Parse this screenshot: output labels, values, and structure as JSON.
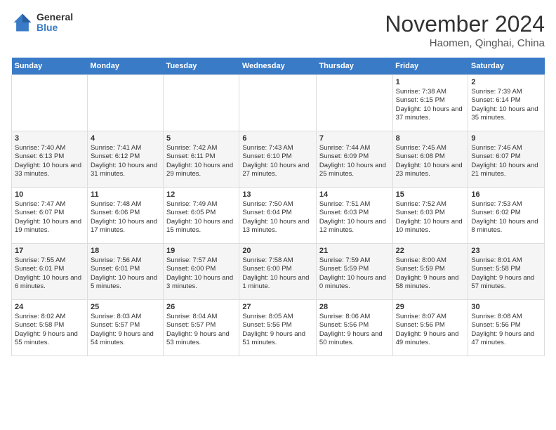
{
  "header": {
    "logo_general": "General",
    "logo_blue": "Blue",
    "month_title": "November 2024",
    "location": "Haomen, Qinghai, China"
  },
  "days_of_week": [
    "Sunday",
    "Monday",
    "Tuesday",
    "Wednesday",
    "Thursday",
    "Friday",
    "Saturday"
  ],
  "weeks": [
    [
      {
        "day": "",
        "sunrise": "",
        "sunset": "",
        "daylight": ""
      },
      {
        "day": "",
        "sunrise": "",
        "sunset": "",
        "daylight": ""
      },
      {
        "day": "",
        "sunrise": "",
        "sunset": "",
        "daylight": ""
      },
      {
        "day": "",
        "sunrise": "",
        "sunset": "",
        "daylight": ""
      },
      {
        "day": "",
        "sunrise": "",
        "sunset": "",
        "daylight": ""
      },
      {
        "day": "1",
        "sunrise": "Sunrise: 7:38 AM",
        "sunset": "Sunset: 6:15 PM",
        "daylight": "Daylight: 10 hours and 37 minutes."
      },
      {
        "day": "2",
        "sunrise": "Sunrise: 7:39 AM",
        "sunset": "Sunset: 6:14 PM",
        "daylight": "Daylight: 10 hours and 35 minutes."
      }
    ],
    [
      {
        "day": "3",
        "sunrise": "Sunrise: 7:40 AM",
        "sunset": "Sunset: 6:13 PM",
        "daylight": "Daylight: 10 hours and 33 minutes."
      },
      {
        "day": "4",
        "sunrise": "Sunrise: 7:41 AM",
        "sunset": "Sunset: 6:12 PM",
        "daylight": "Daylight: 10 hours and 31 minutes."
      },
      {
        "day": "5",
        "sunrise": "Sunrise: 7:42 AM",
        "sunset": "Sunset: 6:11 PM",
        "daylight": "Daylight: 10 hours and 29 minutes."
      },
      {
        "day": "6",
        "sunrise": "Sunrise: 7:43 AM",
        "sunset": "Sunset: 6:10 PM",
        "daylight": "Daylight: 10 hours and 27 minutes."
      },
      {
        "day": "7",
        "sunrise": "Sunrise: 7:44 AM",
        "sunset": "Sunset: 6:09 PM",
        "daylight": "Daylight: 10 hours and 25 minutes."
      },
      {
        "day": "8",
        "sunrise": "Sunrise: 7:45 AM",
        "sunset": "Sunset: 6:08 PM",
        "daylight": "Daylight: 10 hours and 23 minutes."
      },
      {
        "day": "9",
        "sunrise": "Sunrise: 7:46 AM",
        "sunset": "Sunset: 6:07 PM",
        "daylight": "Daylight: 10 hours and 21 minutes."
      }
    ],
    [
      {
        "day": "10",
        "sunrise": "Sunrise: 7:47 AM",
        "sunset": "Sunset: 6:07 PM",
        "daylight": "Daylight: 10 hours and 19 minutes."
      },
      {
        "day": "11",
        "sunrise": "Sunrise: 7:48 AM",
        "sunset": "Sunset: 6:06 PM",
        "daylight": "Daylight: 10 hours and 17 minutes."
      },
      {
        "day": "12",
        "sunrise": "Sunrise: 7:49 AM",
        "sunset": "Sunset: 6:05 PM",
        "daylight": "Daylight: 10 hours and 15 minutes."
      },
      {
        "day": "13",
        "sunrise": "Sunrise: 7:50 AM",
        "sunset": "Sunset: 6:04 PM",
        "daylight": "Daylight: 10 hours and 13 minutes."
      },
      {
        "day": "14",
        "sunrise": "Sunrise: 7:51 AM",
        "sunset": "Sunset: 6:03 PM",
        "daylight": "Daylight: 10 hours and 12 minutes."
      },
      {
        "day": "15",
        "sunrise": "Sunrise: 7:52 AM",
        "sunset": "Sunset: 6:03 PM",
        "daylight": "Daylight: 10 hours and 10 minutes."
      },
      {
        "day": "16",
        "sunrise": "Sunrise: 7:53 AM",
        "sunset": "Sunset: 6:02 PM",
        "daylight": "Daylight: 10 hours and 8 minutes."
      }
    ],
    [
      {
        "day": "17",
        "sunrise": "Sunrise: 7:55 AM",
        "sunset": "Sunset: 6:01 PM",
        "daylight": "Daylight: 10 hours and 6 minutes."
      },
      {
        "day": "18",
        "sunrise": "Sunrise: 7:56 AM",
        "sunset": "Sunset: 6:01 PM",
        "daylight": "Daylight: 10 hours and 5 minutes."
      },
      {
        "day": "19",
        "sunrise": "Sunrise: 7:57 AM",
        "sunset": "Sunset: 6:00 PM",
        "daylight": "Daylight: 10 hours and 3 minutes."
      },
      {
        "day": "20",
        "sunrise": "Sunrise: 7:58 AM",
        "sunset": "Sunset: 6:00 PM",
        "daylight": "Daylight: 10 hours and 1 minute."
      },
      {
        "day": "21",
        "sunrise": "Sunrise: 7:59 AM",
        "sunset": "Sunset: 5:59 PM",
        "daylight": "Daylight: 10 hours and 0 minutes."
      },
      {
        "day": "22",
        "sunrise": "Sunrise: 8:00 AM",
        "sunset": "Sunset: 5:59 PM",
        "daylight": "Daylight: 9 hours and 58 minutes."
      },
      {
        "day": "23",
        "sunrise": "Sunrise: 8:01 AM",
        "sunset": "Sunset: 5:58 PM",
        "daylight": "Daylight: 9 hours and 57 minutes."
      }
    ],
    [
      {
        "day": "24",
        "sunrise": "Sunrise: 8:02 AM",
        "sunset": "Sunset: 5:58 PM",
        "daylight": "Daylight: 9 hours and 55 minutes."
      },
      {
        "day": "25",
        "sunrise": "Sunrise: 8:03 AM",
        "sunset": "Sunset: 5:57 PM",
        "daylight": "Daylight: 9 hours and 54 minutes."
      },
      {
        "day": "26",
        "sunrise": "Sunrise: 8:04 AM",
        "sunset": "Sunset: 5:57 PM",
        "daylight": "Daylight: 9 hours and 53 minutes."
      },
      {
        "day": "27",
        "sunrise": "Sunrise: 8:05 AM",
        "sunset": "Sunset: 5:56 PM",
        "daylight": "Daylight: 9 hours and 51 minutes."
      },
      {
        "day": "28",
        "sunrise": "Sunrise: 8:06 AM",
        "sunset": "Sunset: 5:56 PM",
        "daylight": "Daylight: 9 hours and 50 minutes."
      },
      {
        "day": "29",
        "sunrise": "Sunrise: 8:07 AM",
        "sunset": "Sunset: 5:56 PM",
        "daylight": "Daylight: 9 hours and 49 minutes."
      },
      {
        "day": "30",
        "sunrise": "Sunrise: 8:08 AM",
        "sunset": "Sunset: 5:56 PM",
        "daylight": "Daylight: 9 hours and 47 minutes."
      }
    ]
  ]
}
